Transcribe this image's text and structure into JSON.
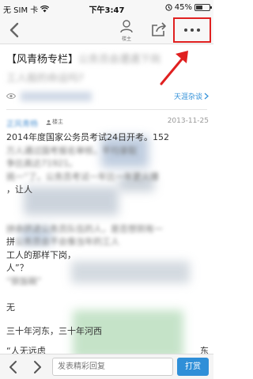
{
  "status_bar": {
    "carrier": "无 SIM 卡",
    "time": "下午3:47",
    "battery_percent": "45%",
    "battery_level": 0.45
  },
  "nav": {
    "owner_label": "楼主",
    "icons": [
      "back-arrow-icon",
      "person-icon",
      "share-icon",
      "more-icon"
    ]
  },
  "post": {
    "title_prefix": "【风青杨专栏】",
    "title_blurred_1": "公务员会遭遇下岗",
    "title_blurred_2": "工人般的命运吗?",
    "board": "天涯杂谈",
    "author": "正风青杨",
    "author_badge": "楼主",
    "date": "2013-11-25",
    "body": {
      "line1": "2014年度国家公务员考试24日开考。152",
      "line2": "万人通过国考报名审核，平均录取",
      "line3": "争比高达71921。",
      "line4": "挑一”了。公务员考试一年比一年更火爆",
      "line5": "，让人",
      "line6": "",
      "line7": "",
      "line8": "",
      "line9": "拼命挤进公务员队伍的人，是否想到有一",
      "line10_a": "拼",
      "line10_b": "公务员会不会像当年的工人",
      "line11": "工人的那样下岗，",
      "line12": "人”？",
      "line13": "“铁饭碗”",
      "line14": "",
      "line15": "无",
      "line16": "",
      "section_heading": "三十年河东，三十年河西",
      "quote_start": "“人无远虑",
      "quote_end": "东"
    }
  },
  "bottom_bar": {
    "reply_placeholder": "发表精彩回复",
    "send_label": "打赏"
  },
  "colors": {
    "accent_blue": "#2f8fd8",
    "highlight_red": "#e02020",
    "date_gray": "#999999"
  }
}
